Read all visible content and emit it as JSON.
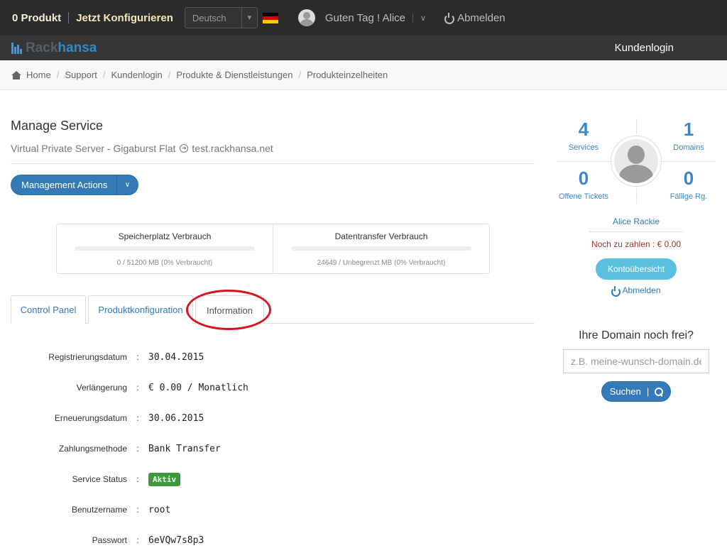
{
  "topbar": {
    "cart": "0 Produkt",
    "configure": "Jetzt Konfigurieren",
    "language": "Deutsch",
    "flag_colors": [
      "#000000",
      "#dd0000",
      "#ffce00"
    ],
    "greeting": "Guten Tag ! Alice",
    "logout": "Abmelden"
  },
  "brand": {
    "logo_part1": "Rack",
    "logo_part2": "hansa",
    "nav_login": "Kundenlogin"
  },
  "breadcrumb": [
    "Home",
    "Support",
    "Kundenlogin",
    "Produkte & Dienstleistungen",
    "Produkteinzelheiten"
  ],
  "main": {
    "title": "Manage Service",
    "product": "Virtual Private Server - Gigaburst Flat",
    "domain": "test.rackhansa.net",
    "management_actions": "Management Actions",
    "usage": [
      {
        "title": "Speicherplatz Verbrauch",
        "text": "0 / 51200 MB (0% Verbraucht)",
        "percent": 0
      },
      {
        "title": "Datentransfer Verbrauch",
        "text": "24649 / Unbegrenzt MB (0% Verbraucht)",
        "percent": 0
      }
    ],
    "tabs": [
      "Control Panel",
      "Produktkonfiguration",
      "Information"
    ],
    "info": [
      {
        "label": "Registrierungsdatum",
        "value": "30.04.2015"
      },
      {
        "label": "Verlängerung",
        "value": "€ 0.00 / Monatlich"
      },
      {
        "label": "Erneuerungsdatum",
        "value": "30.06.2015"
      },
      {
        "label": "Zahlungsmethode",
        "value": "Bank Transfer"
      },
      {
        "label": "Service Status",
        "value": "Aktiv"
      },
      {
        "label": "Benutzername",
        "value": "root"
      },
      {
        "label": "Passwort",
        "value": "6eVQw7s8p3"
      }
    ]
  },
  "sidebar": {
    "stats": [
      {
        "num": "4",
        "label": "Services"
      },
      {
        "num": "1",
        "label": "Domains"
      },
      {
        "num": "0",
        "label": "Offene Tickets"
      },
      {
        "num": "0",
        "label": "Fällige Rg."
      }
    ],
    "user_name": "Alice Rackie",
    "due": "Noch zu zahlen : € 0.00",
    "account_button": "Kontoübersicht",
    "logout": "Abmelden",
    "domain_title": "Ihre Domain noch frei?",
    "domain_placeholder": "z.B. meine-wunsch-domain.de",
    "search_button": "Suchen"
  }
}
